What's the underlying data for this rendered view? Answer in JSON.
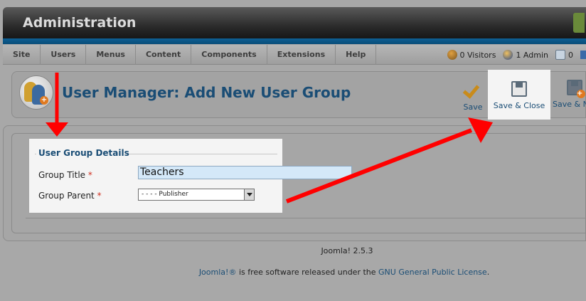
{
  "header": {
    "title": "Administration"
  },
  "menu": {
    "items": [
      "Site",
      "Users",
      "Menus",
      "Content",
      "Components",
      "Extensions",
      "Help"
    ]
  },
  "status": {
    "visitors": "0 Visitors",
    "admins": "1 Admin",
    "messages": "0"
  },
  "toolbar": {
    "page_title": "User Manager: Add New User Group",
    "save_label": "Save",
    "save_close_label": "Save & Close",
    "save_new_label": "Save & N"
  },
  "form": {
    "legend": "User Group Details",
    "group_title_label": "Group Title",
    "group_title_value": "Teachers",
    "group_parent_label": "Group Parent",
    "group_parent_value": "- - - - Publisher",
    "required_marker": "*"
  },
  "footer": {
    "version": "Joomla! 2.5.3",
    "license_link1": "Joomla!®",
    "license_text": " is free software released under the ",
    "license_link2": "GNU General Public License",
    "license_end": "."
  },
  "colors": {
    "annotation_arrow": "#ff0000",
    "title_blue": "#1a4d75",
    "header_stripe": "#0e5f94"
  }
}
